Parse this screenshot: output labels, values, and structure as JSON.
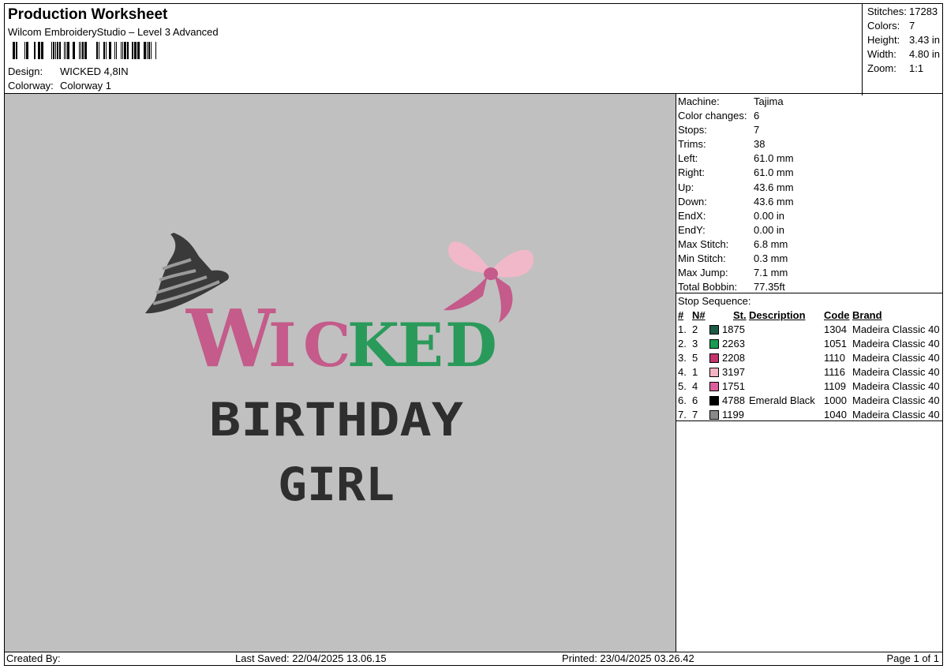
{
  "header": {
    "title": "Production Worksheet",
    "subtitle": "Wilcom EmbroideryStudio – Level 3 Advanced",
    "design_label": "Design:",
    "design_value": "WICKED 4,8IN",
    "colorway_label": "Colorway:",
    "colorway_value": "Colorway 1"
  },
  "summary": [
    {
      "label": "Stitches:",
      "value": "17283"
    },
    {
      "label": "Colors:",
      "value": "7"
    },
    {
      "label": "Height:",
      "value": "3.43 in"
    },
    {
      "label": "Width:",
      "value": "4.80 in"
    },
    {
      "label": "Zoom:",
      "value": "1:1"
    }
  ],
  "machine_info": [
    {
      "label": "Machine:",
      "value": "Tajima"
    },
    {
      "label": "Color changes:",
      "value": "6"
    },
    {
      "label": "Stops:",
      "value": "7"
    },
    {
      "label": "Trims:",
      "value": "38"
    },
    {
      "label": "Left:",
      "value": "61.0 mm"
    },
    {
      "label": "Right:",
      "value": "61.0 mm"
    },
    {
      "label": "Up:",
      "value": "43.6 mm"
    },
    {
      "label": "Down:",
      "value": "43.6 mm"
    },
    {
      "label": "EndX:",
      "value": "0.00 in"
    },
    {
      "label": "EndY:",
      "value": "0.00 in"
    },
    {
      "label": "Max Stitch:",
      "value": "6.8 mm"
    },
    {
      "label": "Min Stitch:",
      "value": "0.3 mm"
    },
    {
      "label": "Max Jump:",
      "value": "7.1 mm"
    },
    {
      "label": "Total Bobbin:",
      "value": "77.35ft"
    }
  ],
  "stop_sequence": {
    "title": "Stop Sequence:",
    "columns": {
      "idx": "#",
      "n": "N#",
      "st": "St.",
      "desc": "Description",
      "code": "Code",
      "brand": "Brand"
    },
    "rows": [
      {
        "idx": "1.",
        "n": "2",
        "color": "#1f5a45",
        "st": "1875",
        "desc": "",
        "code": "1304",
        "brand": "Madeira Classic 40"
      },
      {
        "idx": "2.",
        "n": "3",
        "color": "#1a9a52",
        "st": "2263",
        "desc": "",
        "code": "1051",
        "brand": "Madeira Classic 40"
      },
      {
        "idx": "3.",
        "n": "5",
        "color": "#c0356b",
        "st": "2208",
        "desc": "",
        "code": "1110",
        "brand": "Madeira Classic 40"
      },
      {
        "idx": "4.",
        "n": "1",
        "color": "#f2b4c2",
        "st": "3197",
        "desc": "",
        "code": "1116",
        "brand": "Madeira Classic 40"
      },
      {
        "idx": "5.",
        "n": "4",
        "color": "#d9609a",
        "st": "1751",
        "desc": "",
        "code": "1109",
        "brand": "Madeira Classic 40"
      },
      {
        "idx": "6.",
        "n": "6",
        "color": "#000000",
        "st": "4788",
        "desc": "Emerald Black",
        "code": "1000",
        "brand": "Madeira Classic 40"
      },
      {
        "idx": "7.",
        "n": "7",
        "color": "#8a8a8a",
        "st": "1199",
        "desc": "",
        "code": "1040",
        "brand": "Madeira Classic 40"
      }
    ]
  },
  "design_preview": {
    "background": "#c0c0c0",
    "letters_pink": [
      "W",
      "I",
      "C"
    ],
    "letters_green": [
      "K",
      "E",
      "D"
    ],
    "line2": "BIRTHDAY",
    "line3": "GIRL",
    "pink": "#c45b8a",
    "pink_light": "#f0b8c8",
    "green": "#2a9a5a",
    "dark": "#2e2e2e",
    "hat": "#3a3a3a",
    "hat_stripe": "#9a9a9a"
  },
  "footer": {
    "created_by": "Created By:",
    "last_saved": "Last Saved: 22/04/2025 13.06.15",
    "printed": "Printed: 23/04/2025 03.26.42",
    "page": "Page 1 of 1"
  }
}
